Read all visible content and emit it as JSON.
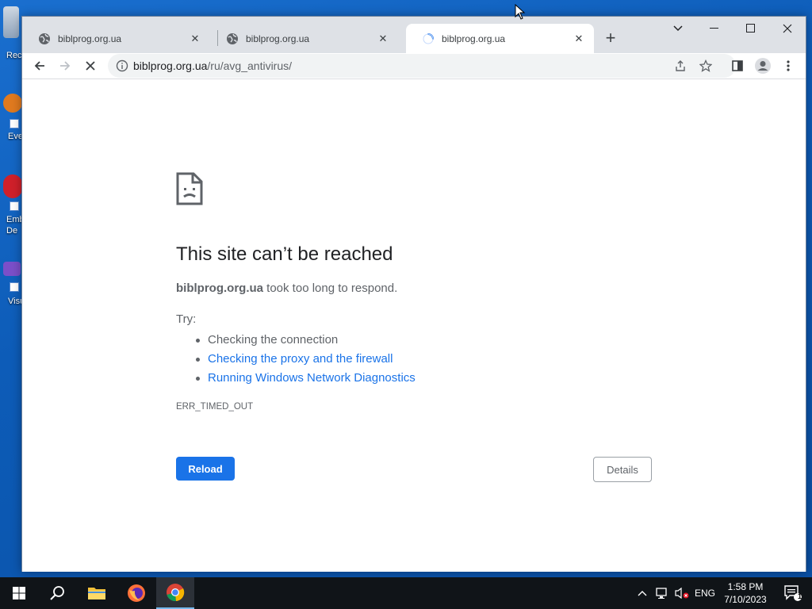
{
  "desktop": {
    "icons": [
      {
        "label": "Rec"
      },
      {
        "label": "Eve"
      },
      {
        "label": "Emb De"
      },
      {
        "label": "Visu"
      }
    ]
  },
  "tabs": [
    {
      "title": "biblprog.org.ua",
      "active": false
    },
    {
      "title": "biblprog.org.ua",
      "active": false
    },
    {
      "title": "biblprog.org.ua",
      "active": true
    }
  ],
  "toolbar": {
    "url_host": "biblprog.org.ua",
    "url_path": "/ru/avg_antivirus/"
  },
  "error_page": {
    "title": "This site can’t be reached",
    "host": "biblprog.org.ua",
    "description": " took too long to respond.",
    "try_label": "Try:",
    "suggestions": [
      {
        "text": "Checking the connection",
        "link": false
      },
      {
        "text": "Checking the proxy and the firewall",
        "link": true
      },
      {
        "text": "Running Windows Network Diagnostics",
        "link": true
      }
    ],
    "error_code": "ERR_TIMED_OUT",
    "reload_label": "Reload",
    "details_label": "Details"
  },
  "taskbar": {
    "language": "ENG",
    "time": "1:58 PM",
    "date": "7/10/2023",
    "notification_count": "1"
  },
  "colors": {
    "accent": "#1a73e8",
    "desktop": "#0d5cb8",
    "taskbar": "#101418"
  }
}
